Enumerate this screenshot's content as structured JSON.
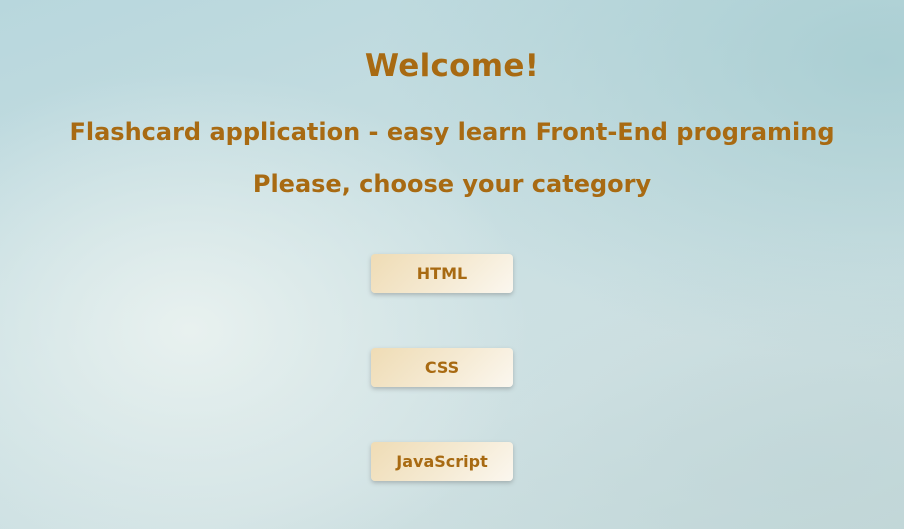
{
  "header": {
    "welcome": "Welcome!",
    "subtitle": "Flashcard application - easy learn Front-End programing",
    "prompt": "Please, choose your category"
  },
  "categories": [
    {
      "label": "HTML"
    },
    {
      "label": "CSS"
    },
    {
      "label": "JavaScript"
    }
  ],
  "colors": {
    "accent_text": "#a86a12",
    "button_bg": "#f5ead3",
    "background": "#c9dfe2"
  }
}
